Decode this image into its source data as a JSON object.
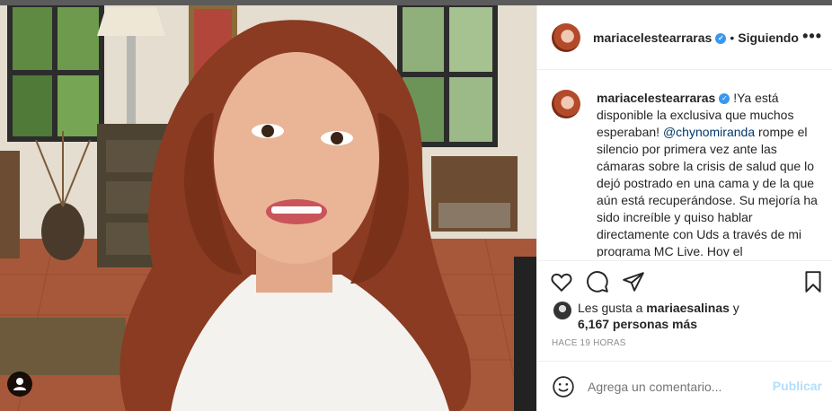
{
  "post": {
    "username": "mariacelestearraras",
    "verified_badge": "✓",
    "separator": "•",
    "follow_status": "Siguiendo",
    "more_icon": "more-horizontal-icon",
    "caption": {
      "username": "mariacelestearraras",
      "text_before": " !Ya está disponible la exclusiva que muchos esperaban! ",
      "mention": "@chynomiranda",
      "text_after": " rompe el silencio por primera vez ante las cámaras sobre la crisis de salud que lo dejó postrado en una cama y de la que aún está recuperándose. Su mejoría ha sido increíble y quiso hablar directamente con Uds a través de mi programa MC Live. Hoy el"
    },
    "likes": {
      "prefix": "Les gusta a ",
      "first_user": "mariaesalinas",
      "joiner": " y",
      "count_text": "6,167 personas más"
    },
    "timestamp": "HACE 19 HORAS",
    "comment": {
      "placeholder": "Agrega un comentario...",
      "publish_label": "Publicar"
    },
    "colors": {
      "accent": "#3897f0",
      "publish_disabled": "#b2dffc",
      "text": "#262626",
      "muted": "#8e8e8e"
    }
  }
}
